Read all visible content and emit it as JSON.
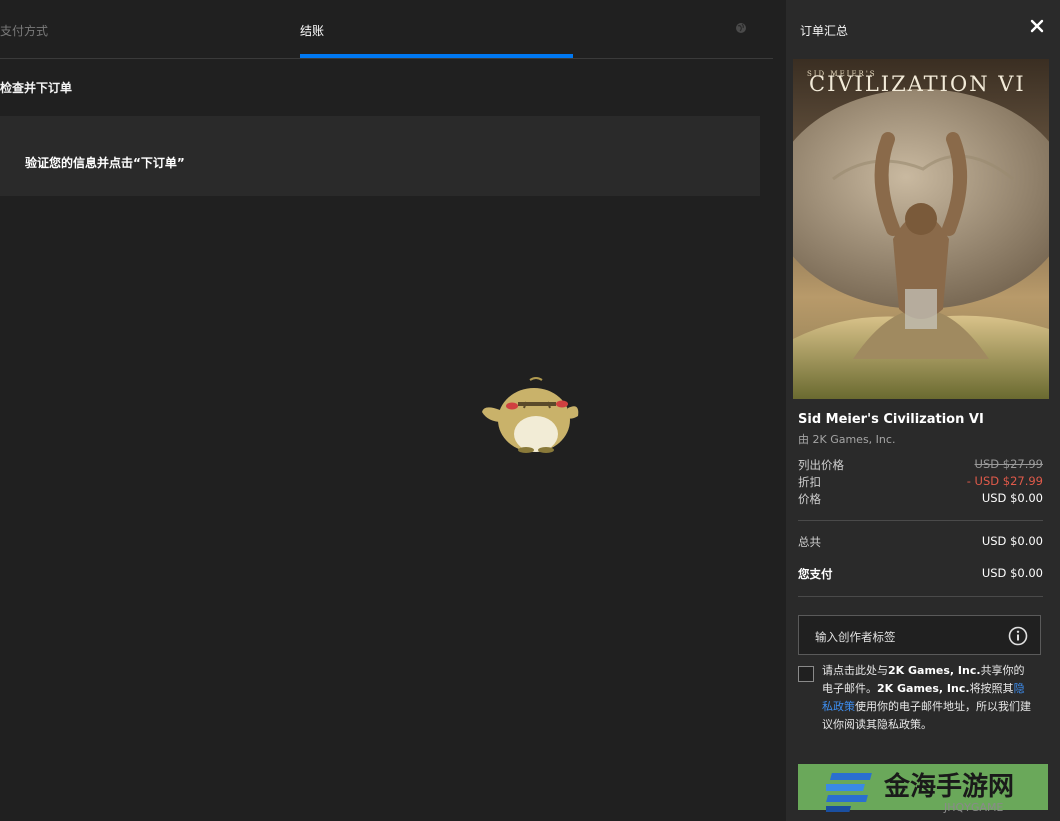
{
  "tabs": {
    "payment": "支付方式",
    "checkout": "结账"
  },
  "review": {
    "title": "检查并下订单",
    "verify": "验证您的信息并点击“下订单”"
  },
  "summary": {
    "title": "订单汇总",
    "cover_title": "CIVILIZATION VI",
    "cover_subtitle": "SID MEIER'S",
    "game_name": "Sid Meier's Civilization VI",
    "publisher": "由 2K Games, Inc.",
    "list_price_label": "列出价格",
    "list_price_value": "USD $27.99",
    "discount_label": "折扣",
    "discount_value": "- USD $27.99",
    "price_label": "价格",
    "price_value": "USD $0.00",
    "total_label": "总共",
    "total_value": "USD $0.00",
    "you_pay_label": "您支付",
    "you_pay_value": "USD $0.00",
    "creator_tag_label": "输入创作者标签",
    "consent": {
      "part1": "请点击此处与",
      "bold1": "2K Games, Inc.",
      "part2": "共享你的电子邮件。",
      "bold2": "2K Games, Inc.",
      "part3": "将按照其",
      "link": "隐私政策",
      "part4": "使用你的电子邮件地址，所以我们建议你阅读其隐私政策。"
    }
  },
  "watermark": {
    "text": "金海手游网",
    "sub": "JHQYGAME"
  },
  "colors": {
    "accent": "#0078f2",
    "discount": "#e05a4a",
    "link": "#3d8ef0",
    "place_order": "#6aa85a",
    "background": "#202020",
    "panel": "#2a2a2a"
  },
  "icons": {
    "globe": "globe-icon",
    "close": "close-icon",
    "info": "info-icon",
    "mascot": "loading-mascot-icon"
  }
}
